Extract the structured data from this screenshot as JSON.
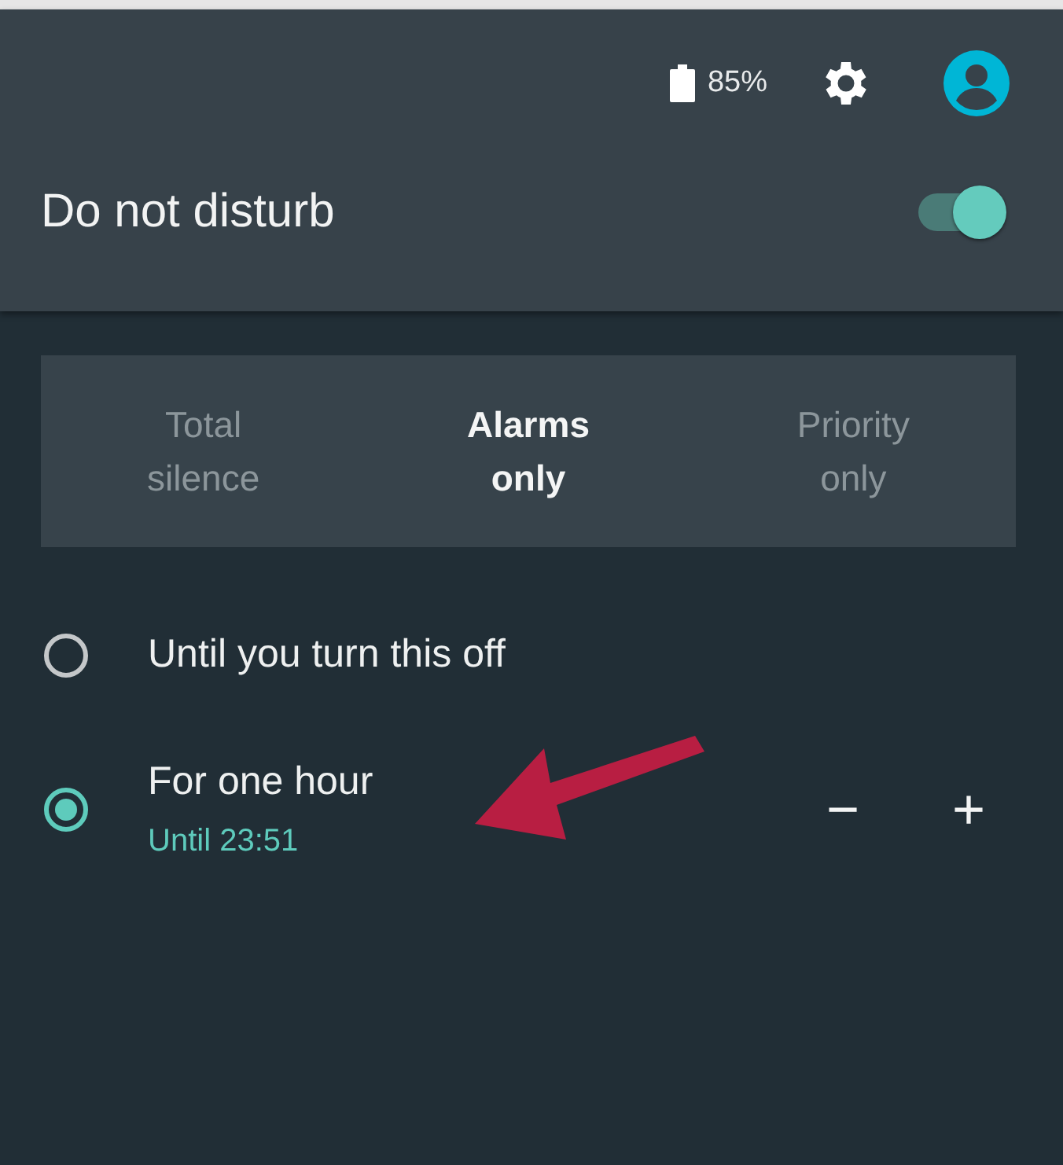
{
  "status_bar": {
    "battery": "85%"
  },
  "header": {
    "title": "Do not disturb",
    "on": true
  },
  "modes": [
    {
      "label": "Total silence",
      "selected": false
    },
    {
      "label": "Alarms only",
      "selected": true
    },
    {
      "label": "Priority only",
      "selected": false
    }
  ],
  "durations": [
    {
      "label": "Until you turn this off",
      "selected": false
    },
    {
      "label": "For one hour",
      "subtitle": "Until 23:51",
      "selected": true,
      "decrease": "−",
      "increase": "+"
    }
  ]
}
